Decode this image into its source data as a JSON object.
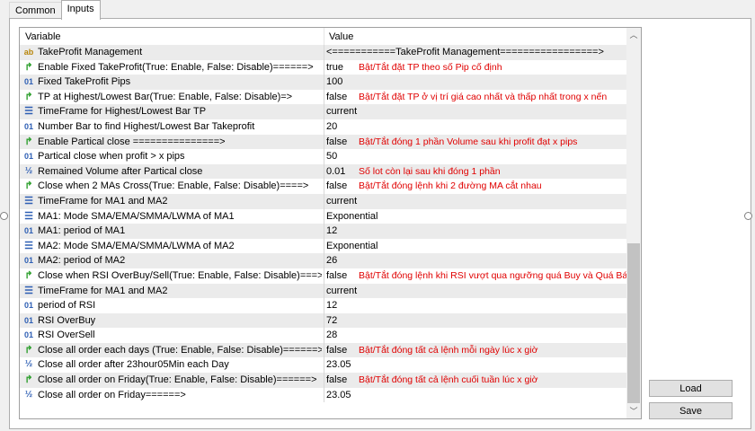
{
  "tabs": [
    "Common",
    "Inputs"
  ],
  "columns": {
    "variable": "Variable",
    "value": "Value"
  },
  "rows": [
    {
      "icon": "ab",
      "variable": "TakeProfit Management",
      "value": "<===========TakeProfit Management=================>",
      "note": ""
    },
    {
      "icon": "bool",
      "variable": "Enable Fixed TakeProfit(True: Enable, False: Disable)======>",
      "value": "true",
      "note": "Bật/Tắt đặt TP theo số Pip cố định"
    },
    {
      "icon": "01",
      "variable": "Fixed TakeProfit Pips",
      "value": "100",
      "note": ""
    },
    {
      "icon": "bool",
      "variable": "TP at Highest/Lowest Bar(True: Enable, False: Disable)=>",
      "value": "false",
      "note": "Bật/Tắt đặt TP ở vị trí giá cao nhất và thấp nhất trong x nến"
    },
    {
      "icon": "tf",
      "variable": "TimeFrame for Highest/Lowest Bar TP",
      "value": "current",
      "note": ""
    },
    {
      "icon": "01",
      "variable": "Number Bar to find Highest/Lowest Bar Takeprofit",
      "value": "20",
      "note": ""
    },
    {
      "icon": "bool",
      "variable": "Enable  Partical close ===============>",
      "value": "false",
      "note": "Bật/Tắt đóng 1 phần Volume sau khi profit đạt x pips"
    },
    {
      "icon": "01",
      "variable": "Partical close when profit > x pips",
      "value": "50",
      "note": ""
    },
    {
      "icon": "half",
      "variable": "Remained Volume after Partical close",
      "value": "0.01",
      "note": "Số lot còn lại sau khi đóng 1 phần"
    },
    {
      "icon": "bool",
      "variable": "Close when 2 MAs Cross(True: Enable, False: Disable)====>",
      "value": "false",
      "note": "Bật/Tắt đóng lệnh khi 2 đường MA cắt nhau"
    },
    {
      "icon": "tf",
      "variable": "TimeFrame for MA1 and MA2",
      "value": "current",
      "note": ""
    },
    {
      "icon": "tf",
      "variable": "MA1: Mode SMA/EMA/SMMA/LWMA of MA1",
      "value": "Exponential",
      "note": ""
    },
    {
      "icon": "01",
      "variable": "MA1: period of MA1",
      "value": "12",
      "note": ""
    },
    {
      "icon": "tf",
      "variable": "MA2: Mode SMA/EMA/SMMA/LWMA of MA2",
      "value": "Exponential",
      "note": ""
    },
    {
      "icon": "01",
      "variable": "MA2: period of MA2",
      "value": "26",
      "note": ""
    },
    {
      "icon": "bool",
      "variable": "Close when RSI OverBuy/Sell(True: Enable, False: Disable)===>",
      "value": "false",
      "note": "Bật/Tắt đóng lệnh khi RSI vượt qua ngưỡng quá Buy và Quá Bán"
    },
    {
      "icon": "tf",
      "variable": "TimeFrame for MA1 and MA2",
      "value": "current",
      "note": ""
    },
    {
      "icon": "01",
      "variable": "period of RSI",
      "value": "12",
      "note": ""
    },
    {
      "icon": "01",
      "variable": "RSI OverBuy",
      "value": "72",
      "note": ""
    },
    {
      "icon": "01",
      "variable": "RSI OverSell",
      "value": "28",
      "note": ""
    },
    {
      "icon": "bool",
      "variable": "Close all order each days (True: Enable, False: Disable)======>",
      "value": "false",
      "note": "Bật/Tắt đóng tất cả lệnh mỗi ngày lúc x giờ"
    },
    {
      "icon": "half",
      "variable": "Close all order after 23hour05Min each Day",
      "value": "23.05",
      "note": ""
    },
    {
      "icon": "bool",
      "variable": "Close all order on Friday(True: Enable, False: Disable)======>",
      "value": "false",
      "note": "Bật/Tắt đóng tất cả lệnh cuối tuần lúc x giờ"
    },
    {
      "icon": "half",
      "variable": "Close all order on Friday======>",
      "value": "23.05",
      "note": ""
    }
  ],
  "icon_glyphs": {
    "ab": "ab",
    "01": "01",
    "half": "½",
    "tf": "☰",
    "bool": "↱"
  },
  "icon_names": {
    "ab": "string-type-icon",
    "01": "integer-type-icon",
    "half": "double-type-icon",
    "tf": "enum-type-icon",
    "bool": "bool-type-icon"
  },
  "buttons": {
    "load": "Load",
    "save": "Save"
  },
  "colors": {
    "note": "#e00000",
    "row_alt": "#ebebeb"
  }
}
